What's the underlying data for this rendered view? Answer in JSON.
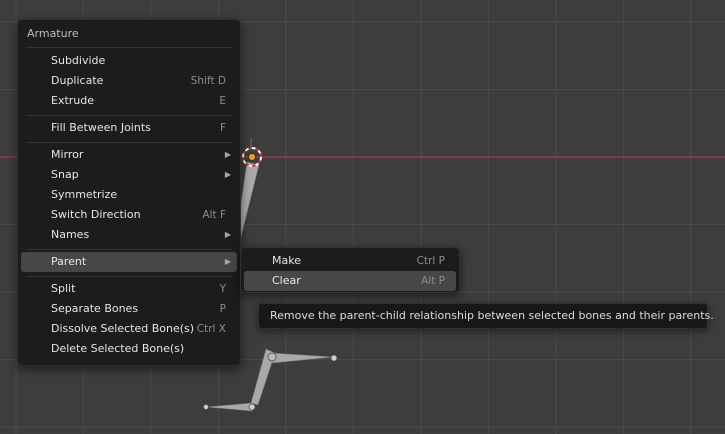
{
  "colors": {
    "viewport_bg": "#3d3d3d",
    "grid_line": "#4a4a4a",
    "x_axis": "#c43a4f",
    "menu_bg": "#1c1c1c",
    "highlight": "#474747",
    "bone": "#a9a9a9"
  },
  "main_menu": {
    "title": "Armature",
    "items": [
      {
        "label": "Subdivide",
        "shortcut": ""
      },
      {
        "label": "Duplicate",
        "shortcut": "Shift D"
      },
      {
        "label": "Extrude",
        "shortcut": "E"
      },
      {
        "label": "Fill Between Joints",
        "shortcut": "F"
      },
      {
        "label": "Mirror",
        "submenu": true
      },
      {
        "label": "Snap",
        "submenu": true
      },
      {
        "label": "Symmetrize",
        "shortcut": ""
      },
      {
        "label": "Switch Direction",
        "shortcut": "Alt F"
      },
      {
        "label": "Names",
        "submenu": true
      },
      {
        "label": "Parent",
        "submenu": true,
        "active": true
      },
      {
        "label": "Split",
        "shortcut": "Y"
      },
      {
        "label": "Separate Bones",
        "shortcut": "P"
      },
      {
        "label": "Dissolve Selected Bone(s)",
        "shortcut": "Ctrl X"
      },
      {
        "label": "Delete Selected Bone(s)",
        "shortcut": ""
      }
    ]
  },
  "parent_submenu": {
    "items": [
      {
        "label": "Make",
        "shortcut": "Ctrl P"
      },
      {
        "label": "Clear",
        "shortcut": "Alt P",
        "active": true
      }
    ]
  },
  "tooltip": {
    "text": "Remove the parent-child relationship between selected bones and their parents."
  }
}
